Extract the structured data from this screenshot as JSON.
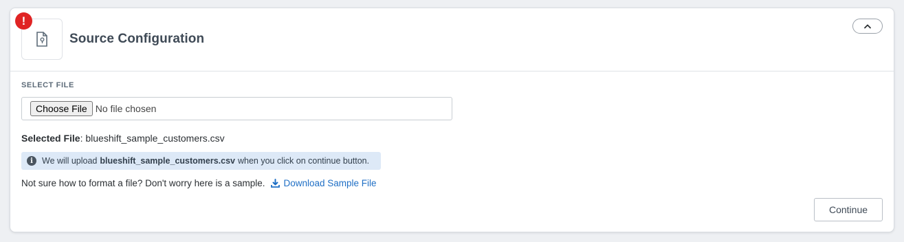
{
  "panel": {
    "title": "Source Configuration",
    "error_badge": "!",
    "icon": "file-settings-icon",
    "collapse_icon": "chevron-up-icon"
  },
  "select_file": {
    "label": "SELECT FILE",
    "choose_button": "Choose File",
    "status": "No file chosen"
  },
  "selected_file": {
    "label": "Selected File",
    "separator": ":",
    "value": "blueshift_sample_customers.csv"
  },
  "info": {
    "icon": "info-icon",
    "prefix": "We will upload",
    "filename": "blueshift_sample_customers.csv",
    "suffix": "when you click on continue button."
  },
  "sample": {
    "text": "Not sure how to format a file? Don't worry here is a sample.",
    "link_label": "Download Sample File",
    "link_icon": "download-icon"
  },
  "actions": {
    "continue_label": "Continue"
  },
  "colors": {
    "error": "#e02424",
    "info_bg": "#dde9f7",
    "link": "#1f6fc5"
  }
}
